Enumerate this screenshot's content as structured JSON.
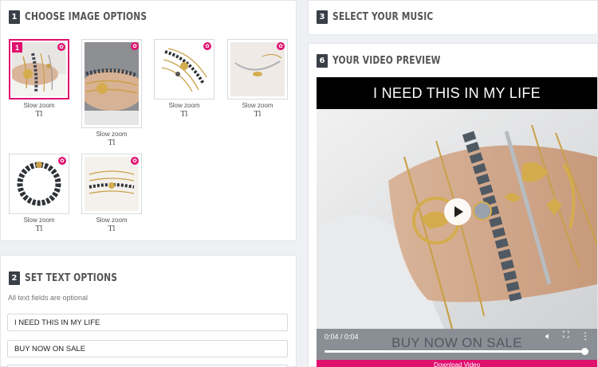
{
  "image_options": {
    "step": "1",
    "title": "CHOOSE IMAGE OPTIONS",
    "items": [
      {
        "caption": "Slow zoom",
        "text_icon": "Tl",
        "badge": "1",
        "selected": true
      },
      {
        "caption": "Slow zoom",
        "text_icon": "Tl",
        "selected": false
      },
      {
        "caption": "Slow zoom",
        "text_icon": "Tl",
        "selected": false
      },
      {
        "caption": "Slow zoom",
        "text_icon": "Tl",
        "selected": false
      },
      {
        "caption": "Slow zoom",
        "text_icon": "Tl",
        "selected": false
      },
      {
        "caption": "Slow zoom",
        "text_icon": "Tl",
        "selected": false
      }
    ]
  },
  "text_options": {
    "step": "2",
    "title": "SET TEXT OPTIONS",
    "hint": "All text fields are optional",
    "fields": [
      {
        "value": "I NEED THIS IN MY LIFE"
      },
      {
        "value": "BUY NOW ON SALE"
      }
    ]
  },
  "music": {
    "step": "3",
    "title": "SELECT YOUR MUSIC"
  },
  "preview": {
    "step": "6",
    "title": "YOUR VIDEO PREVIEW",
    "top_text": "I NEED THIS IN MY LIFE",
    "bottom_text": "BUY NOW ON SALE",
    "time": "0:04 / 0:04",
    "progress_fraction": 1.0,
    "download_label": "Download Video"
  },
  "colors": {
    "accent": "#e0106f",
    "header_badge": "#3a3f47"
  },
  "icons": [
    "gear-icon",
    "play-icon",
    "volume-icon",
    "fullscreen-icon",
    "more-icon"
  ]
}
